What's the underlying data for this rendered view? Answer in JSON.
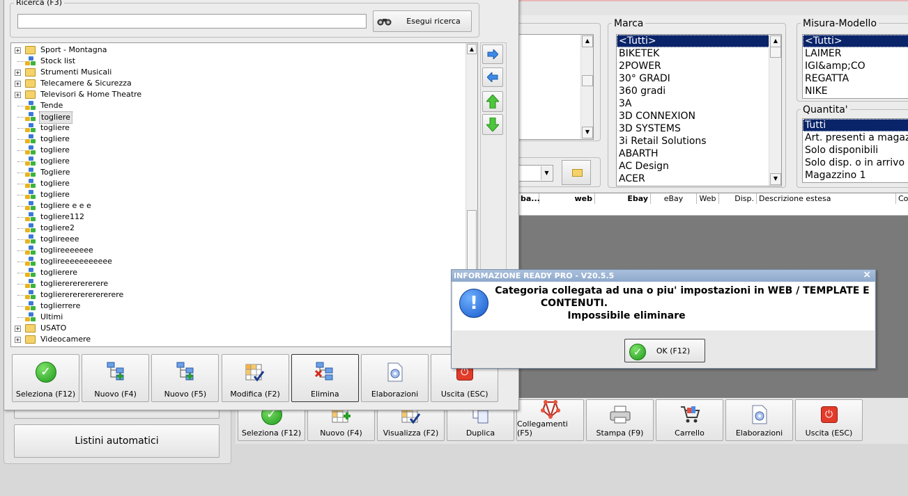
{
  "left_dialog": {
    "search_group_label": "Ricerca (F3)",
    "search_value": "",
    "search_button_label": "Esegui ricerca",
    "tree_items": [
      {
        "label": "Sport - Montagna",
        "kind": "folder",
        "expander": true
      },
      {
        "label": "Stock list",
        "kind": "node",
        "expander": false
      },
      {
        "label": "Strumenti Musicali",
        "kind": "folder",
        "expander": true
      },
      {
        "label": "Telecamere & Sicurezza",
        "kind": "folder",
        "expander": true
      },
      {
        "label": "Televisori & Home Theatre",
        "kind": "folder",
        "expander": true
      },
      {
        "label": "Tende",
        "kind": "node",
        "expander": false
      },
      {
        "label": "togliere",
        "kind": "node",
        "expander": false,
        "selected": true
      },
      {
        "label": "togliere",
        "kind": "node",
        "expander": false
      },
      {
        "label": "togliere",
        "kind": "node",
        "expander": false
      },
      {
        "label": "togliere",
        "kind": "node",
        "expander": false
      },
      {
        "label": "togliere",
        "kind": "node",
        "expander": false
      },
      {
        "label": "Togliere",
        "kind": "node",
        "expander": false
      },
      {
        "label": "togliere",
        "kind": "node",
        "expander": false
      },
      {
        "label": "togliere",
        "kind": "node",
        "expander": false
      },
      {
        "label": "togliere e e e",
        "kind": "node",
        "expander": false
      },
      {
        "label": "togliere112",
        "kind": "node",
        "expander": false
      },
      {
        "label": "togliere2",
        "kind": "node",
        "expander": false
      },
      {
        "label": "toglireeee",
        "kind": "node",
        "expander": false
      },
      {
        "label": "toglireeeeeee",
        "kind": "node",
        "expander": false
      },
      {
        "label": "toglireeeeeeeeeee",
        "kind": "node",
        "expander": false
      },
      {
        "label": "toglierere",
        "kind": "node",
        "expander": false
      },
      {
        "label": "toglierererererere",
        "kind": "node",
        "expander": false
      },
      {
        "label": "toglierererererererere",
        "kind": "node",
        "expander": false
      },
      {
        "label": "toglierrere",
        "kind": "node",
        "expander": false
      },
      {
        "label": "Ultimi",
        "kind": "node",
        "expander": false
      },
      {
        "label": "USATO",
        "kind": "folder",
        "expander": true
      },
      {
        "label": "Videocamere",
        "kind": "folder",
        "expander": true
      }
    ],
    "buttons": [
      {
        "label": "Seleziona (F12)",
        "icon": "check-icon"
      },
      {
        "label": "Nuovo (F4)",
        "icon": "tree-add-icon"
      },
      {
        "label": "Nuovo (F5)",
        "icon": "tree-add-child-icon"
      },
      {
        "label": "Modifica (F2)",
        "icon": "grid-edit-icon"
      },
      {
        "label": "Elimina",
        "icon": "tree-delete-icon"
      },
      {
        "label": "Elaborazioni",
        "icon": "gear-document-icon"
      },
      {
        "label": "Uscita (ESC)",
        "icon": "exit-icon"
      }
    ]
  },
  "listini_button_label": "Listini automatici",
  "marca": {
    "label": "Marca",
    "items": [
      "<Tutti>",
      " BIKETEK",
      "2POWER",
      "30° GRADI",
      "360 gradi",
      "3A",
      "3D CONNEXION",
      "3D SYSTEMS",
      "3i Retail Solutions",
      "ABARTH",
      "AC Design",
      "ACER"
    ],
    "selected_index": 0
  },
  "misura": {
    "label": "Misura-Modello",
    "items": [
      "<Tutti>",
      "LAIMER",
      "IGI&amp;CO",
      "REGATTA",
      "NIKE"
    ],
    "selected_index": 0
  },
  "quantita": {
    "label": "Quantita'",
    "items": [
      "Tutti",
      "Art. presenti a magazz",
      "Solo disponibili",
      "Solo disp. o in arrivo",
      "Magazzino 1"
    ],
    "selected_index": 0
  },
  "grid_headers": [
    "ba...",
    "web",
    "Ebay",
    "eBay",
    "Web",
    "Disp.",
    "Descrizione estesa",
    "Coc"
  ],
  "bottom_buttons": [
    {
      "label": "Seleziona (F12)",
      "icon": "check-icon"
    },
    {
      "label": "Nuovo (F4)",
      "icon": "grid-add-icon"
    },
    {
      "label": "Visualizza (F2)",
      "icon": "grid-view-icon"
    },
    {
      "label": "Duplica",
      "icon": "duplicate-icon"
    },
    {
      "label": "Collegamenti (F5)",
      "icon": "links-icon"
    },
    {
      "label": "Stampa (F9)",
      "icon": "printer-icon"
    },
    {
      "label": "Carrello",
      "icon": "cart-icon"
    },
    {
      "label": "Elaborazioni",
      "icon": "gear-document-icon"
    },
    {
      "label": "Uscita (ESC)",
      "icon": "exit-icon"
    }
  ],
  "info_dialog": {
    "title": "INFORMAZIONE READY PRO - V20.5.5",
    "close_glyph": "×",
    "message_line1": "Categoria collegata ad una o piu' impostazioni in WEB / TEMPLATE E",
    "message_line2": "CONTENUTI.",
    "message_line3": "Impossibile eliminare",
    "ok_label": "OK (F12)",
    "icon": "info-exclamation-icon"
  },
  "colors": {
    "selection": "#0a246a",
    "dialog_title_bg": "#9ab3d3",
    "dark_area": "#7a7a7a"
  }
}
